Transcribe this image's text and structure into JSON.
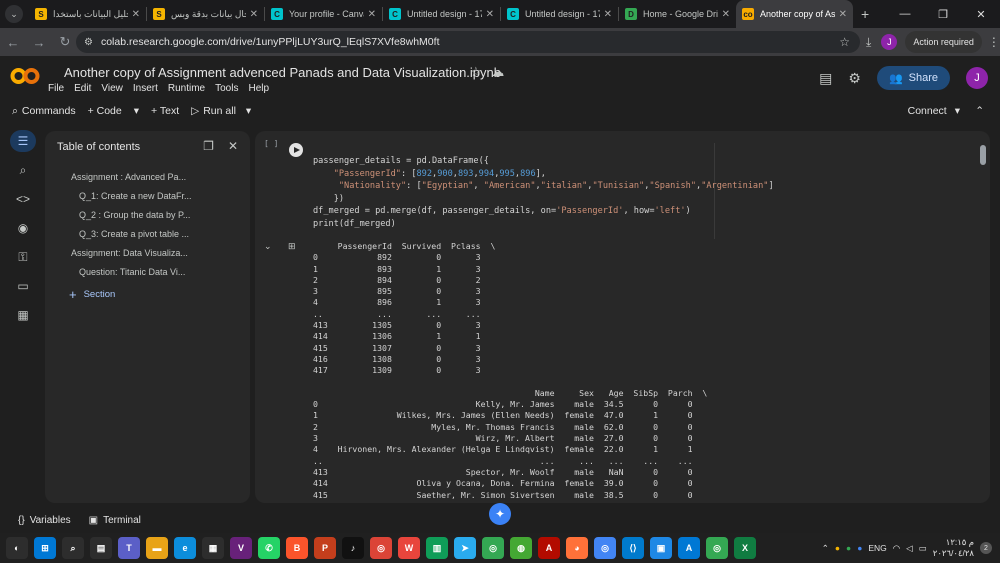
{
  "browser": {
    "tabs": [
      {
        "label": "تحليل البيانات باستخدا",
        "favicon": "S",
        "color": "#f4b400",
        "active": false
      },
      {
        "label": "إدخال بيانات بدقة وبس",
        "favicon": "S",
        "color": "#f4b400",
        "active": false
      },
      {
        "label": "Your profile - Canva",
        "favicon": "C",
        "color": "#00c4cc",
        "active": false
      },
      {
        "label": "Untitled design - 170",
        "favicon": "C",
        "color": "#00c4cc",
        "active": false
      },
      {
        "label": "Untitled design - 170",
        "favicon": "C",
        "color": "#00c4cc",
        "active": false
      },
      {
        "label": "Home - Google Drive",
        "favicon": "D",
        "color": "#34a853",
        "active": false
      },
      {
        "label": "Another copy of Assig",
        "favicon": "co",
        "color": "#f9ab00",
        "active": true
      }
    ],
    "url": "colab.research.google.com/drive/1unyPPljLUY3urQ_lEqlS7XVfe8whM0ft",
    "profile_initial": "J",
    "action_required": "Action required"
  },
  "colab": {
    "title": "Another copy of Assignment advenced Panads and Data Visualization.ipynb",
    "menu": [
      "File",
      "Edit",
      "View",
      "Insert",
      "Runtime",
      "Tools",
      "Help"
    ],
    "share_label": "Share",
    "avatar": "J",
    "toolbar": {
      "commands": "Commands",
      "code": "+ Code",
      "text": "+ Text",
      "run_all": "Run all",
      "connect": "Connect"
    }
  },
  "toc": {
    "title": "Table of contents",
    "items": [
      {
        "label": "Assignment : Advanced Pa...",
        "level": 1
      },
      {
        "label": "Q_1: Create a new DataFr...",
        "level": 2
      },
      {
        "label": "Q_2 : Group the data by P...",
        "level": 2
      },
      {
        "label": "Q_3: Create a pivot table ...",
        "level": 2
      },
      {
        "label": "Assignment: Data Visualiza...",
        "level": 1
      },
      {
        "label": "Question: Titanic Data Vi...",
        "level": 2
      }
    ],
    "section_label": "Section"
  },
  "cell": {
    "exec_count": "[ ]",
    "output": "     PassengerId  Survived  Pclass  \\\n0            892         0       3\n1            893         1       3\n2            894         0       2\n3            895         0       3\n4            896         1       3\n..           ...       ...     ...\n413         1305         0       3\n414         1306         1       1\n415         1307         0       3\n416         1308         0       3\n417         1309         0       3\n\n                                             Name     Sex   Age  SibSp  Parch  \\\n0                                Kelly, Mr. James    male  34.5      0      0\n1                Wilkes, Mrs. James (Ellen Needs)  female  47.0      1      0\n2                       Myles, Mr. Thomas Francis    male  62.0      0      0\n3                                Wirz, Mr. Albert    male  27.0      0      0\n4    Hirvonen, Mrs. Alexander (Helga E Lindqvist)  female  22.0      1      1\n..                                            ...     ...   ...    ...    ...\n413                            Spector, Mr. Woolf    male   NaN      0      0\n414                  Oliva y Ocana, Dona. Fermina  female  39.0      0      0\n415                  Saether, Mr. Simon Sivertsen    male  38.5      0      0"
  },
  "bottom": {
    "variables": "Variables",
    "terminal": "Terminal"
  },
  "taskbar": {
    "lang": "ENG",
    "time": "م ١٢:١٥",
    "date": "٢٠٢٦/٠٤/٢٨",
    "notif_count": "2"
  }
}
